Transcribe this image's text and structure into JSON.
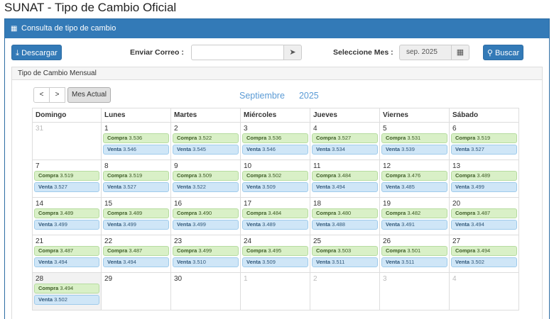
{
  "page": {
    "title": "SUNAT - Tipo de Cambio Oficial"
  },
  "panel": {
    "header": "Consulta de tipo de cambio"
  },
  "toolbar": {
    "download_label": "Descargar",
    "email_label": "Enviar Correo :",
    "email_value": "",
    "month_label": "Seleccione Mes :",
    "month_value": "sep. 2025",
    "search_label": "Buscar"
  },
  "calendar_panel": {
    "header": "Tipo de Cambio Mensual"
  },
  "calendar": {
    "prev_label": "<",
    "next_label": ">",
    "today_label": "Mes Actual",
    "month": "Septiembre",
    "year": "2025",
    "buy_label": "Compra",
    "sell_label": "Venta",
    "weekdays": [
      "Domingo",
      "Lunes",
      "Martes",
      "Miércoles",
      "Jueves",
      "Viernes",
      "Sábado"
    ],
    "weeks": [
      [
        {
          "day": "31",
          "other": true
        },
        {
          "day": "1",
          "buy": "3.536",
          "sell": "3.546"
        },
        {
          "day": "2",
          "buy": "3.522",
          "sell": "3.545"
        },
        {
          "day": "3",
          "buy": "3.536",
          "sell": "3.546"
        },
        {
          "day": "4",
          "buy": "3.527",
          "sell": "3.534"
        },
        {
          "day": "5",
          "buy": "3.531",
          "sell": "3.539"
        },
        {
          "day": "6",
          "buy": "3.519",
          "sell": "3.527"
        }
      ],
      [
        {
          "day": "7",
          "buy": "3.519",
          "sell": "3.527"
        },
        {
          "day": "8",
          "buy": "3.519",
          "sell": "3.527"
        },
        {
          "day": "9",
          "buy": "3.509",
          "sell": "3.522"
        },
        {
          "day": "10",
          "buy": "3.502",
          "sell": "3.509"
        },
        {
          "day": "11",
          "buy": "3.484",
          "sell": "3.494"
        },
        {
          "day": "12",
          "buy": "3.476",
          "sell": "3.485"
        },
        {
          "day": "13",
          "buy": "3.489",
          "sell": "3.499"
        }
      ],
      [
        {
          "day": "14",
          "buy": "3.489",
          "sell": "3.499"
        },
        {
          "day": "15",
          "buy": "3.489",
          "sell": "3.499"
        },
        {
          "day": "16",
          "buy": "3.490",
          "sell": "3.499"
        },
        {
          "day": "17",
          "buy": "3.484",
          "sell": "3.489"
        },
        {
          "day": "18",
          "buy": "3.480",
          "sell": "3.488"
        },
        {
          "day": "19",
          "buy": "3.482",
          "sell": "3.491"
        },
        {
          "day": "20",
          "buy": "3.487",
          "sell": "3.494"
        }
      ],
      [
        {
          "day": "21",
          "buy": "3.487",
          "sell": "3.494"
        },
        {
          "day": "22",
          "buy": "3.487",
          "sell": "3.494"
        },
        {
          "day": "23",
          "buy": "3.499",
          "sell": "3.510"
        },
        {
          "day": "24",
          "buy": "3.495",
          "sell": "3.509"
        },
        {
          "day": "25",
          "buy": "3.503",
          "sell": "3.511"
        },
        {
          "day": "26",
          "buy": "3.501",
          "sell": "3.511"
        },
        {
          "day": "27",
          "buy": "3.494",
          "sell": "3.502"
        }
      ],
      [
        {
          "day": "28",
          "buy": "3.494",
          "sell": "3.502",
          "today": true
        },
        {
          "day": "29"
        },
        {
          "day": "30"
        },
        {
          "day": "1",
          "other": true
        },
        {
          "day": "2",
          "other": true
        },
        {
          "day": "3",
          "other": true
        },
        {
          "day": "4",
          "other": true
        }
      ]
    ]
  },
  "colors": {
    "primary": "#337ab7",
    "buy_bg": "#d9f0c7",
    "sell_bg": "#cfe6f7",
    "title_blue": "#5b9bd5"
  },
  "icons": {
    "calendar": "calendar-icon",
    "download": "download-icon",
    "send": "paper-plane-icon",
    "search": "search-icon"
  }
}
